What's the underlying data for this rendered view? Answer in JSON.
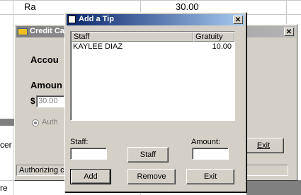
{
  "background": {
    "top_left_text": "Ra",
    "top_right_text": "30.00",
    "left_fragments": [
      "cer",
      "re"
    ]
  },
  "credit_card_window": {
    "title": "Credit Ca",
    "account_label": "Accou",
    "amount_label": "Amoun",
    "currency_symbol": "$",
    "amount_value": "30.00",
    "radio_label": "Auth",
    "exit_button": "Exit",
    "status_text": "Authorizing ca"
  },
  "tip_dialog": {
    "title": "Add a Tip",
    "columns": [
      "Staff",
      "Gratuity"
    ],
    "rows": [
      {
        "staff": "KAYLEE DIAZ",
        "gratuity": "10.00"
      }
    ],
    "staff_label": "Staff:",
    "staff_value": "",
    "amount_label": "Amount:",
    "amount_value": "",
    "staff_button": "Staff",
    "add_button": "Add",
    "remove_button": "Remove",
    "exit_button": "Exit"
  }
}
